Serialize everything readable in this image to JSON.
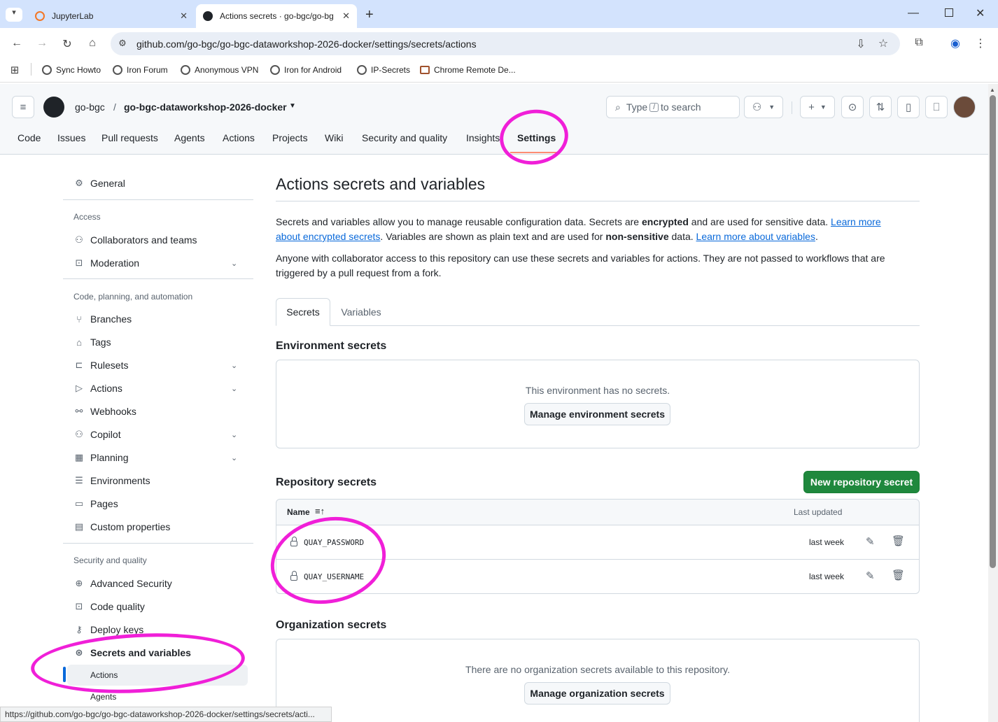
{
  "browser": {
    "tabs": [
      {
        "label": "JupyterLab"
      },
      {
        "label": "Actions secrets · go-bgc/go-bg"
      }
    ],
    "new_tab": "+",
    "url": "github.com/go-bgc/go-bgc-dataworkshop-2026-docker/settings/secrets/actions",
    "bookmarks": [
      "Sync Howto",
      "Iron Forum",
      "Anonymous VPN",
      "Iron for Android",
      "IP-Secrets",
      "Chrome Remote De..."
    ],
    "status_url": "https://github.com/go-bgc/go-bgc-dataworkshop-2026-docker/settings/secrets/acti..."
  },
  "header": {
    "owner": "go-bgc",
    "separator": "/",
    "repo": "go-bgc-dataworkshop-2026-docker",
    "search_placeholder_pre": "Type",
    "search_key": "/",
    "search_placeholder_post": "to search",
    "nav": [
      "Code",
      "Issues",
      "Pull requests",
      "Agents",
      "Actions",
      "Projects",
      "Wiki",
      "Security and quality",
      "Insights",
      "Settings"
    ]
  },
  "sidebar": {
    "general": "General",
    "access_heading": "Access",
    "access": [
      "Collaborators and teams",
      "Moderation"
    ],
    "code_heading": "Code, planning, and automation",
    "code": [
      "Branches",
      "Tags",
      "Rulesets",
      "Actions",
      "Webhooks",
      "Copilot",
      "Planning",
      "Environments",
      "Pages",
      "Custom properties"
    ],
    "security_heading": "Security and quality",
    "security": [
      "Advanced Security",
      "Code quality",
      "Deploy keys",
      "Secrets and variables"
    ],
    "sub": [
      "Actions",
      "Agents"
    ]
  },
  "main": {
    "title": "Actions secrets and variables",
    "p1_a": "Secrets and variables allow you to manage reusable configuration data. Secrets are ",
    "p1_b": "encrypted",
    "p1_c": " and are used for sensitive data. ",
    "p1_link1": "Learn more about encrypted secrets",
    "p1_d": ". Variables are shown as plain text and are used for ",
    "p1_e": "non-sensitive",
    "p1_f": " data. ",
    "p1_link2": "Learn more about variables",
    "p1_g": ".",
    "p2": "Anyone with collaborator access to this repository can use these secrets and variables for actions. They are not passed to workflows that are triggered by a pull request from a fork.",
    "tabs": [
      "Secrets",
      "Variables"
    ],
    "env_heading": "Environment secrets",
    "env_empty": "This environment has no secrets.",
    "env_button": "Manage environment secrets",
    "repo_heading": "Repository secrets",
    "new_secret_button": "New repository secret",
    "col_name": "Name",
    "col_updated": "Last updated",
    "secrets": [
      {
        "name": "QUAY_PASSWORD",
        "updated": "last week"
      },
      {
        "name": "QUAY_USERNAME",
        "updated": "last week"
      }
    ],
    "org_heading": "Organization secrets",
    "org_empty": "There are no organization secrets available to this repository.",
    "org_button": "Manage organization secrets"
  },
  "colors": {
    "accent": "#0969da",
    "primary_button": "#1f883d",
    "annotation": "#f01fd8"
  }
}
